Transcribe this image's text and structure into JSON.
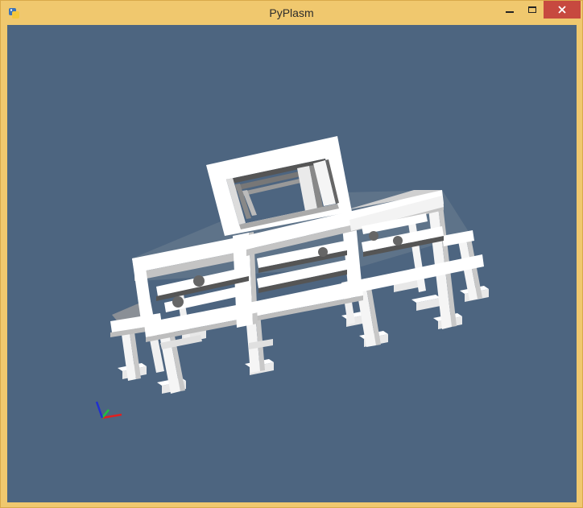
{
  "window": {
    "title": "PyPlasm",
    "icon": "python-icon",
    "controls": [
      "minimize-icon",
      "maximize-icon",
      "close-icon"
    ]
  },
  "viewport": {
    "background_color": "#4d6580",
    "content": "3d-building-frame-model",
    "axis_gizmo": {
      "x_color": "#e02020",
      "y_color": "#20c040",
      "z_color": "#2030d0"
    }
  },
  "colors": {
    "frame": "#f2f2f2",
    "frame_shadow": "#b8b8b8",
    "titlebar": "#f0c86e",
    "close_button": "#c7493f"
  }
}
